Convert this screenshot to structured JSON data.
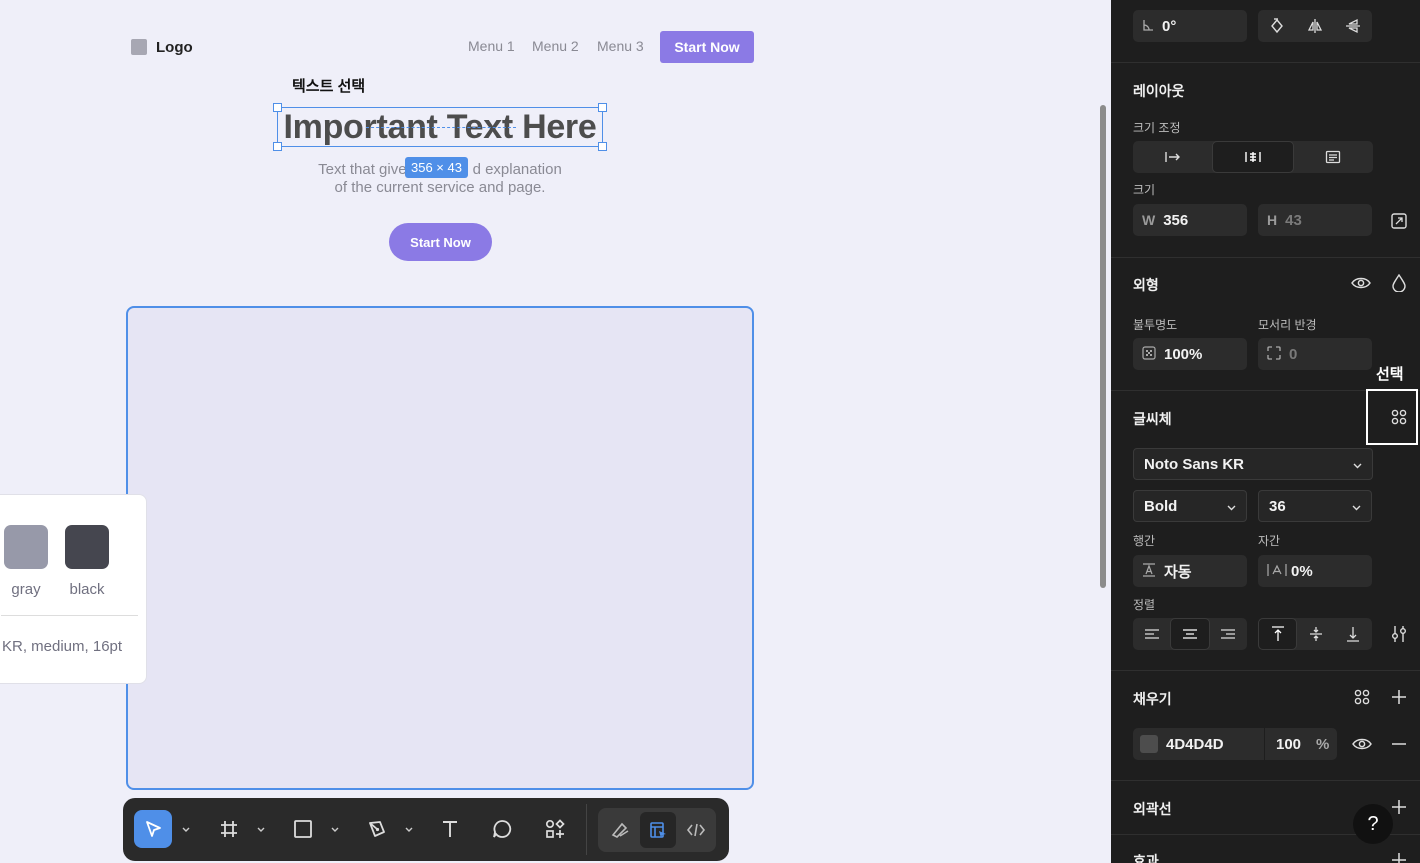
{
  "canvas": {
    "nav": {
      "logo": "Logo",
      "menus": [
        "Menu 1",
        "Menu 2",
        "Menu 3"
      ],
      "cta": "Start Now"
    },
    "selection_label": "텍스트 선택",
    "headline": "Important Text Here",
    "dimension_badge": "356 × 43",
    "subtitle_line1_left": "Text that give",
    "subtitle_line1_right": "d explanation",
    "subtitle_line2": "of the current service and page.",
    "hero_cta": "Start Now",
    "side_card": {
      "swatches": [
        {
          "label": "gray",
          "color": "#9799a9"
        },
        {
          "label": "black",
          "color": "#45464f"
        }
      ],
      "font_note": "KR, medium, 16pt"
    }
  },
  "panel": {
    "rotation": "0°",
    "layout": {
      "title": "레이아웃",
      "resize_label": "크기 조정",
      "size_label": "크기",
      "width_prefix": "W",
      "width": "356",
      "height_prefix": "H",
      "height": "43"
    },
    "appearance": {
      "title": "외형",
      "opacity_label": "불투명도",
      "opacity": "100%",
      "radius_label": "모서리 반경",
      "radius": "0"
    },
    "highlight_label": "선택",
    "typography": {
      "title": "글씨체",
      "font_family": "Noto Sans KR",
      "font_weight": "Bold",
      "font_size": "36",
      "line_height_label": "행간",
      "line_height": "자동",
      "letter_spacing_label": "자간",
      "letter_spacing": "0%",
      "align_label": "정렬"
    },
    "fill": {
      "title": "채우기",
      "hex": "4D4D4D",
      "swatch": "#4D4D4D",
      "opacity": "100",
      "unit": "%"
    },
    "stroke": {
      "title": "외곽선"
    },
    "effects": {
      "title": "효과"
    },
    "help": "?"
  }
}
